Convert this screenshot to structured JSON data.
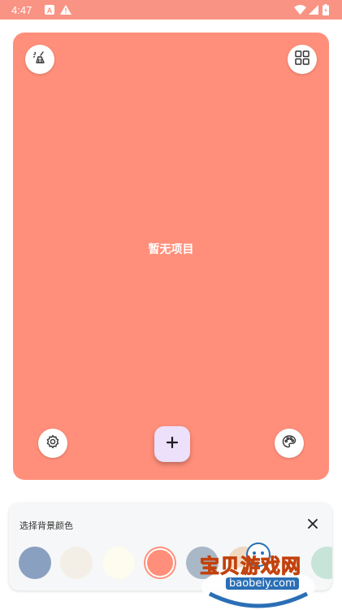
{
  "status_bar": {
    "time": "4:47",
    "icons": [
      "notification-a-icon",
      "warning-icon",
      "wifi-icon",
      "signal-icon",
      "battery-icon"
    ]
  },
  "card": {
    "background": "#ff8f7a",
    "empty_text": "暂无项目",
    "top_left_icon": "clear-brush-icon",
    "top_right_icon": "grid-view-icon",
    "bottom_left_icon": "settings-icon",
    "bottom_right_icon": "palette-icon",
    "add_icon": "plus-icon"
  },
  "color_panel": {
    "title": "选择背景颜色",
    "close_icon": "close-icon",
    "swatches": [
      {
        "color": "#8aa0c0"
      },
      {
        "color": "#f3efe7"
      },
      {
        "color": "#fdfcef"
      },
      {
        "color": "#ff8f7a",
        "selected": true
      },
      {
        "color": "#a9b8c6"
      },
      {
        "color": "#f0d9c2"
      },
      {
        "color": "#c7e4d9"
      }
    ]
  },
  "watermark": {
    "text": "宝贝游戏网",
    "url": "baobeiy.com"
  }
}
